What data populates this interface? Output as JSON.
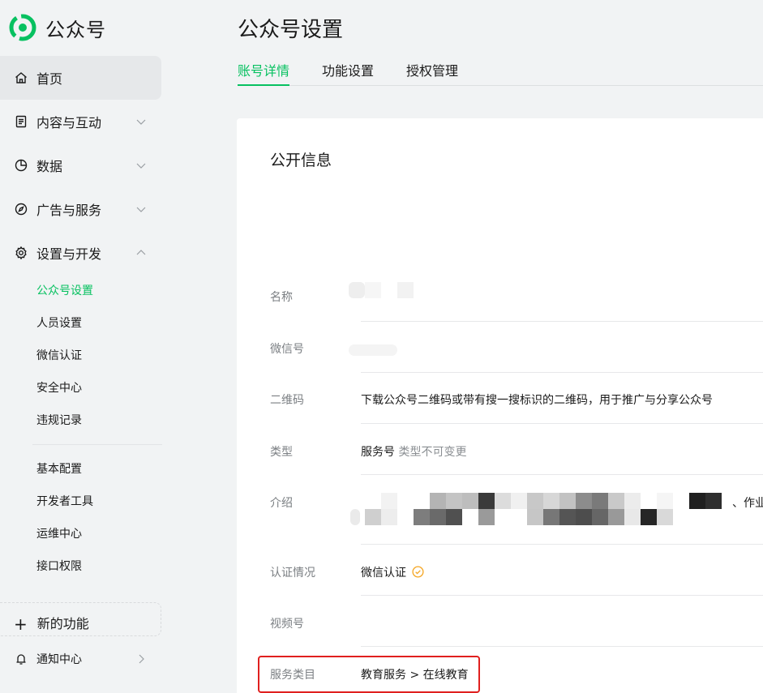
{
  "brand": {
    "name": "公众号",
    "logo_color": "#07c160"
  },
  "sidebar": {
    "nav": [
      {
        "label": "首页",
        "icon": "home-icon"
      },
      {
        "label": "内容与互动",
        "icon": "document-icon"
      },
      {
        "label": "数据",
        "icon": "pie-chart-icon"
      },
      {
        "label": "广告与服务",
        "icon": "compass-icon"
      },
      {
        "label": "设置与开发",
        "icon": "gear-icon"
      }
    ],
    "sub_group_1": [
      "公众号设置",
      "人员设置",
      "微信认证",
      "安全中心",
      "违规记录"
    ],
    "sub_group_2": [
      "基本配置",
      "开发者工具",
      "运维中心",
      "接口权限"
    ],
    "new_feature": "新的功能",
    "notice": "通知中心"
  },
  "header": {
    "title": "公众号设置",
    "tabs": [
      {
        "label": "账号详情",
        "active": true
      },
      {
        "label": "功能设置",
        "active": false
      },
      {
        "label": "授权管理",
        "active": false
      }
    ]
  },
  "card": {
    "section_title": "公开信息",
    "rows": {
      "name": {
        "label": "名称"
      },
      "wechat_id": {
        "label": "微信号"
      },
      "qrcode": {
        "label": "二维码",
        "value": "下载公众号二维码或带有搜一搜标识的二维码，用于推广与分享公众号"
      },
      "type": {
        "label": "类型",
        "value": "服务号",
        "note": "类型不可变更"
      },
      "intro": {
        "label": "介绍",
        "visible_tail": "、作业"
      },
      "verify": {
        "label": "认证情况",
        "value": "微信认证"
      },
      "channels": {
        "label": "视频号"
      },
      "category": {
        "label": "服务类目",
        "value": "教育服务 > 在线教育"
      }
    }
  },
  "colors": {
    "accent": "#07c160",
    "highlight": "#e0201f",
    "verify": "#f5a623"
  }
}
